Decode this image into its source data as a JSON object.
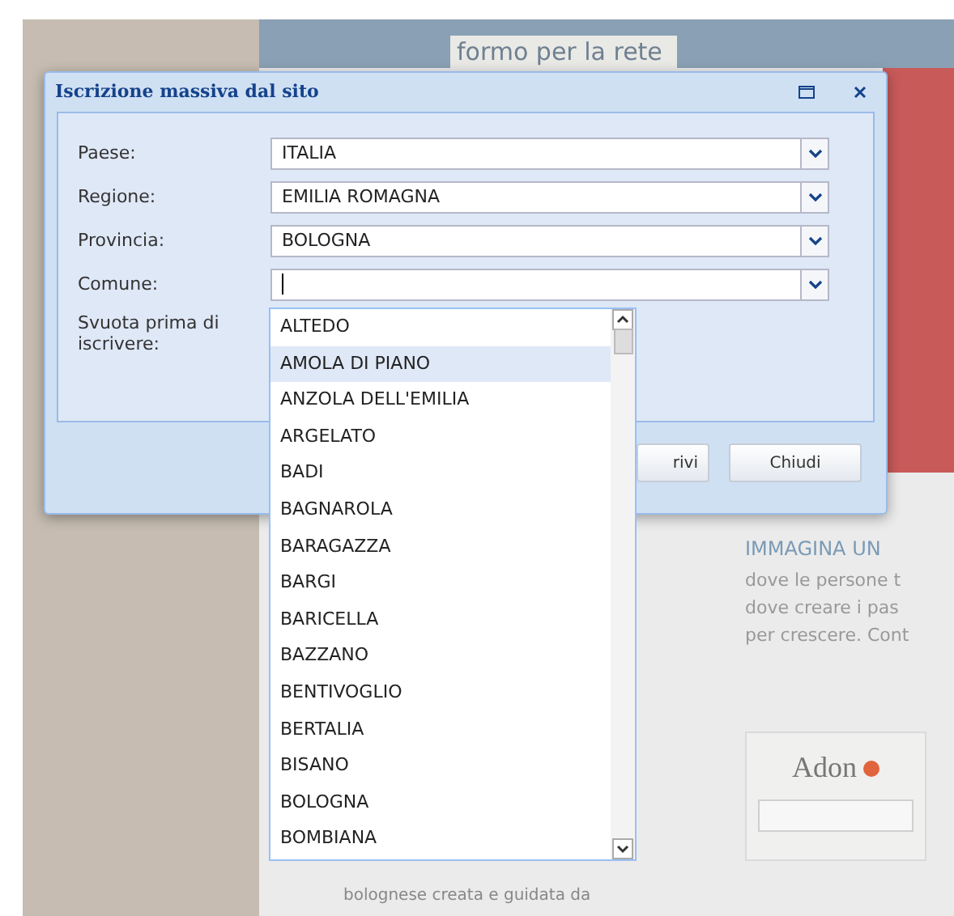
{
  "background_page": {
    "header_text": "formo per la rete",
    "headline": "IMMAGINA UN",
    "body_lines": [
      "dove le persone t",
      "dove creare i pas",
      "per crescere. Cont"
    ],
    "logo_text": "Adon",
    "footer_text": "bolognese creata e guidata da"
  },
  "dialog": {
    "title": "Iscrizione massiva dal sito",
    "fields": [
      {
        "label": "Paese:",
        "value": "ITALIA"
      },
      {
        "label": "Regione:",
        "value": "EMILIA ROMAGNA"
      },
      {
        "label": "Provincia:",
        "value": "BOLOGNA"
      },
      {
        "label": "Comune:"
      }
    ],
    "clear_label": "Svuota prima di iscrivere:",
    "buttons": [
      "rivi",
      "Chiudi"
    ]
  },
  "dropdown": {
    "items": [
      {
        "label": "ALTEDO",
        "selected": false
      },
      {
        "label": "AMOLA DI PIANO",
        "selected": true
      },
      {
        "label": "ANZOLA DELL'EMILIA",
        "selected": false
      },
      {
        "label": "ARGELATO",
        "selected": false
      },
      {
        "label": "BADI",
        "selected": false
      },
      {
        "label": "BAGNAROLA",
        "selected": false
      },
      {
        "label": "BARAGAZZA",
        "selected": false
      },
      {
        "label": "BARGI",
        "selected": false
      },
      {
        "label": "BARICELLA",
        "selected": false
      },
      {
        "label": "BAZZANO",
        "selected": false
      },
      {
        "label": "BENTIVOGLIO",
        "selected": false
      },
      {
        "label": "BERTALIA",
        "selected": false
      },
      {
        "label": "BISANO",
        "selected": false
      },
      {
        "label": "BOLOGNA",
        "selected": false
      },
      {
        "label": "BOMBIANA",
        "selected": false
      }
    ]
  }
}
